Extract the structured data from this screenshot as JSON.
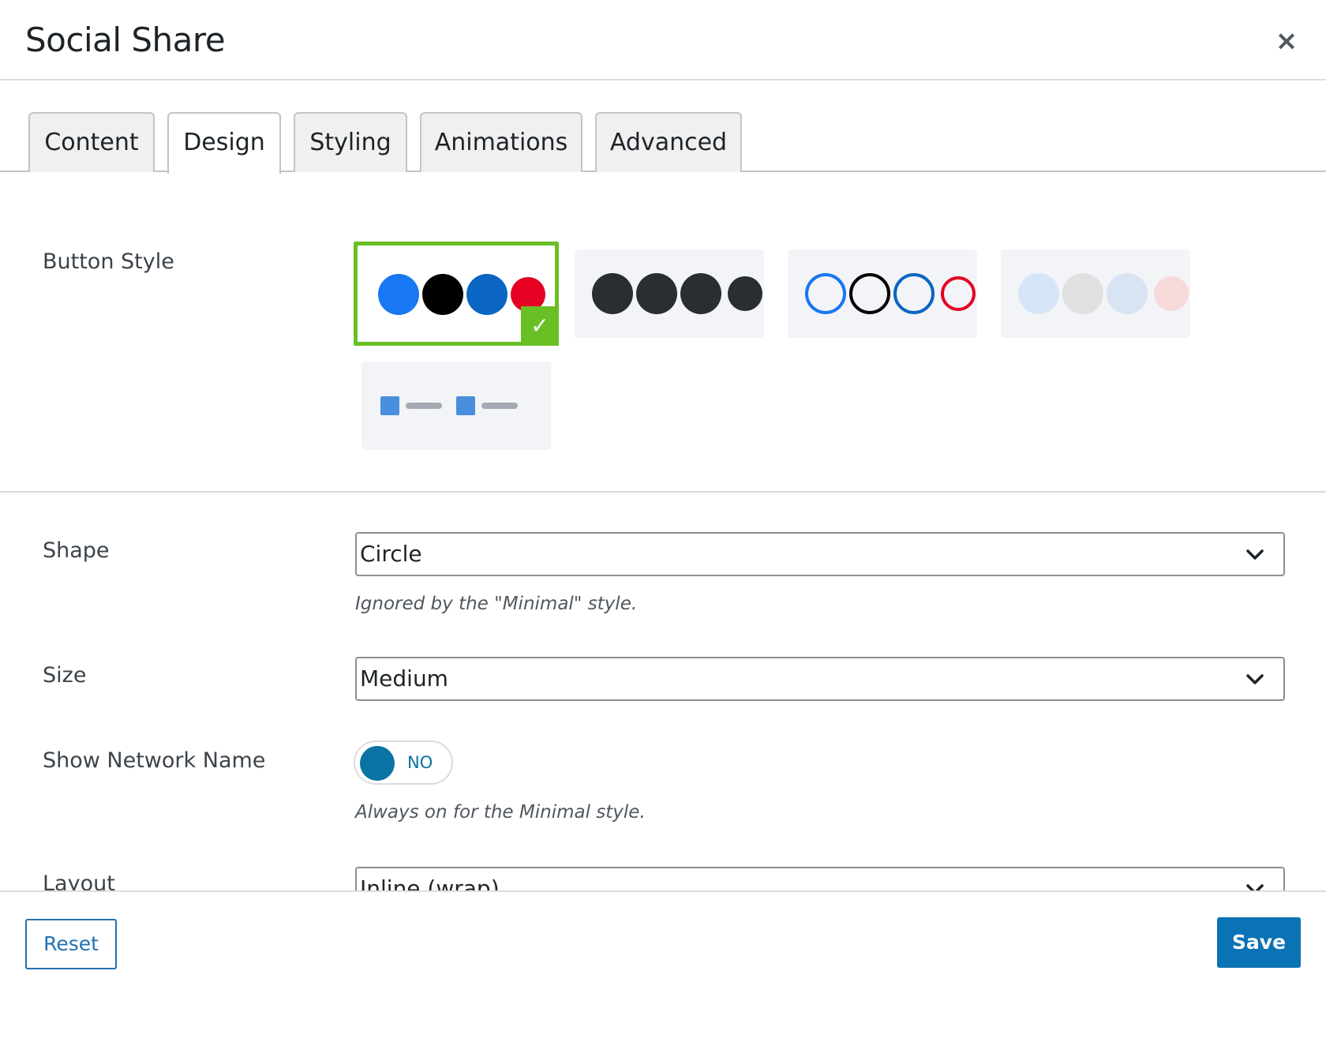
{
  "dialog": {
    "title": "Social Share",
    "close_icon": "×"
  },
  "tabs": [
    {
      "label": "Content",
      "active": false
    },
    {
      "label": "Design",
      "active": true
    },
    {
      "label": "Styling",
      "active": false
    },
    {
      "label": "Animations",
      "active": false
    },
    {
      "label": "Advanced",
      "active": false
    }
  ],
  "fields": {
    "button_style": {
      "label": "Button Style",
      "options": [
        {
          "name": "colored-circles",
          "selected": true,
          "colors": [
            "#1877f2",
            "#000000",
            "#0a66c2",
            "#e60023"
          ]
        },
        {
          "name": "dark-circles",
          "selected": false,
          "colors": [
            "#2a2e33",
            "#2a2e33",
            "#2a2e33",
            "#2a2e33"
          ]
        },
        {
          "name": "outline-circles",
          "selected": false,
          "colors": [
            "#1877f2",
            "#000000",
            "#0a66c2",
            "#e60023"
          ]
        },
        {
          "name": "light-circles",
          "selected": false,
          "colors": [
            "#d7e5f9",
            "#e0e0e0",
            "#d8e4f3",
            "#f8d9d9"
          ]
        },
        {
          "name": "minimal",
          "selected": false
        }
      ]
    },
    "shape": {
      "label": "Shape",
      "value": "Circle",
      "hint": "Ignored by the \"Minimal\" style."
    },
    "size": {
      "label": "Size",
      "value": "Medium"
    },
    "show_network_name": {
      "label": "Show Network Name",
      "state": "NO",
      "hint": "Always on for the Minimal style."
    },
    "layout": {
      "label": "Layout",
      "value": "Inline (wrap)"
    }
  },
  "footer": {
    "reset_label": "Reset",
    "save_label": "Save"
  },
  "colors": {
    "selected_border": "#6abf25",
    "primary": "#0a73b5",
    "toggle": "#0a73a3"
  },
  "icons": {
    "check": "check-icon",
    "chevron": "chevron-down-icon",
    "close": "close-icon"
  }
}
